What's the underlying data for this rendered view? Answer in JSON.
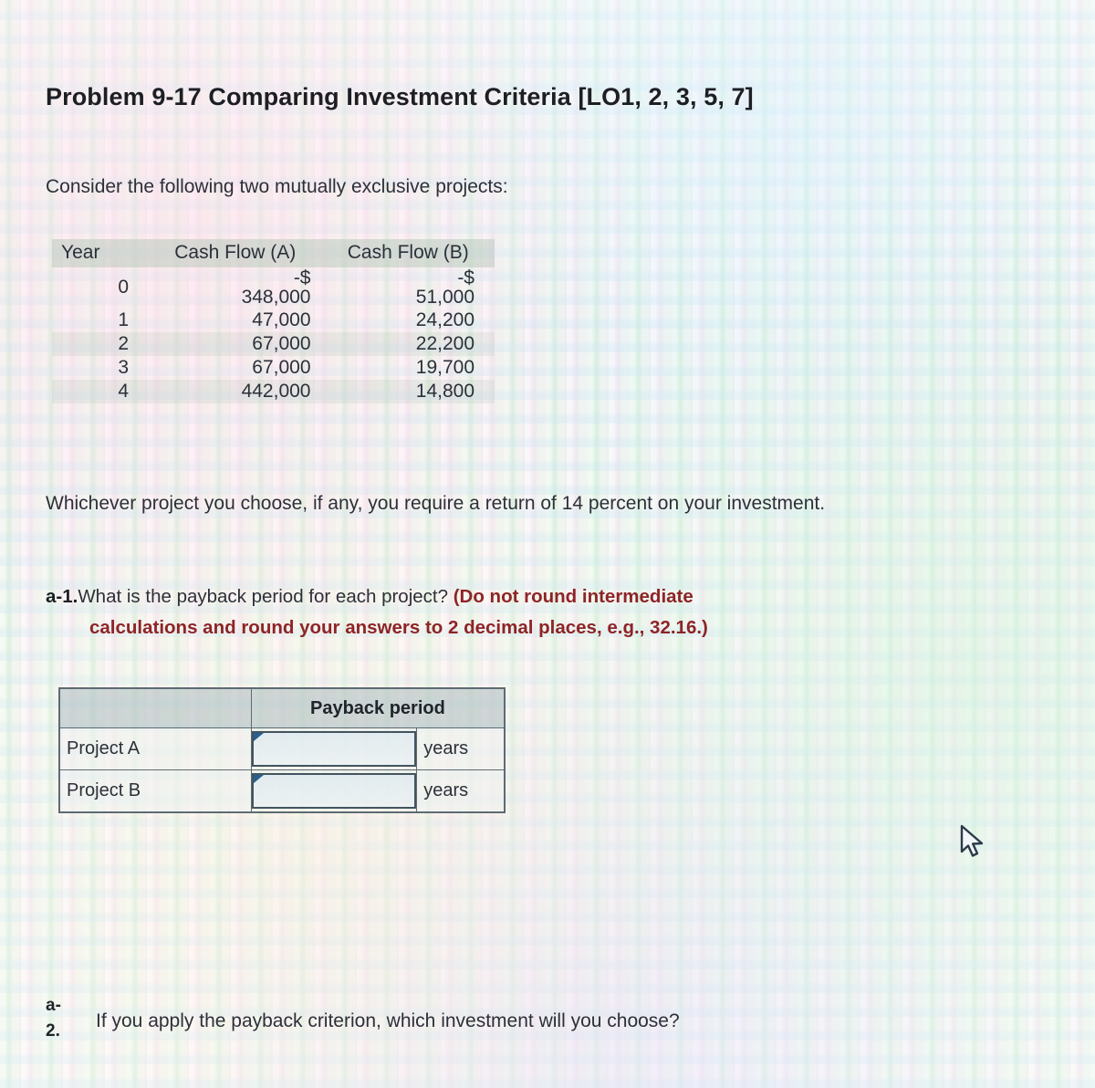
{
  "title": "Problem 9-17 Comparing Investment Criteria [LO1, 2, 3, 5, 7]",
  "intro": "Consider the following two mutually exclusive projects:",
  "cash_flow_table": {
    "headers": [
      "Year",
      "Cash Flow (A)",
      "Cash Flow (B)"
    ],
    "rows": [
      {
        "year": "0",
        "a_prefix": "-$",
        "a": "348,000",
        "b_prefix": "-$",
        "b": "51,000"
      },
      {
        "year": "1",
        "a_prefix": "",
        "a": "47,000",
        "b_prefix": "",
        "b": "24,200"
      },
      {
        "year": "2",
        "a_prefix": "",
        "a": "67,000",
        "b_prefix": "",
        "b": "22,200"
      },
      {
        "year": "3",
        "a_prefix": "",
        "a": "67,000",
        "b_prefix": "",
        "b": "19,700"
      },
      {
        "year": "4",
        "a_prefix": "",
        "a": "442,000",
        "b_prefix": "",
        "b": "14,800"
      }
    ]
  },
  "requirement": "Whichever project you choose, if any, you require a return of 14 percent on your investment.",
  "question_a1": {
    "label": "a-1.",
    "text": "What is the payback period for each project? ",
    "emphasis_line1": "(Do not round intermediate",
    "emphasis_line2": "calculations and round your answers to 2 decimal places, e.g., 32.16.)"
  },
  "answer_table": {
    "header_blank": "",
    "header_metric": "Payback period",
    "rows": [
      {
        "label": "Project A",
        "value": "",
        "unit": "years"
      },
      {
        "label": "Project B",
        "value": "",
        "unit": "years"
      }
    ]
  },
  "question_a2": {
    "label_line1": "a-",
    "label_line2": "2.",
    "text": "If you apply the payback criterion, which investment will you choose?"
  },
  "colors": {
    "text": "#2c3039",
    "heading": "#1d1f25",
    "emphasis_red": "#8e2427",
    "table_border": "#5d6b72",
    "input_border": "#43545e",
    "input_marker": "#1f4f78"
  },
  "cursor": {
    "icon": "arrow-pointer"
  }
}
